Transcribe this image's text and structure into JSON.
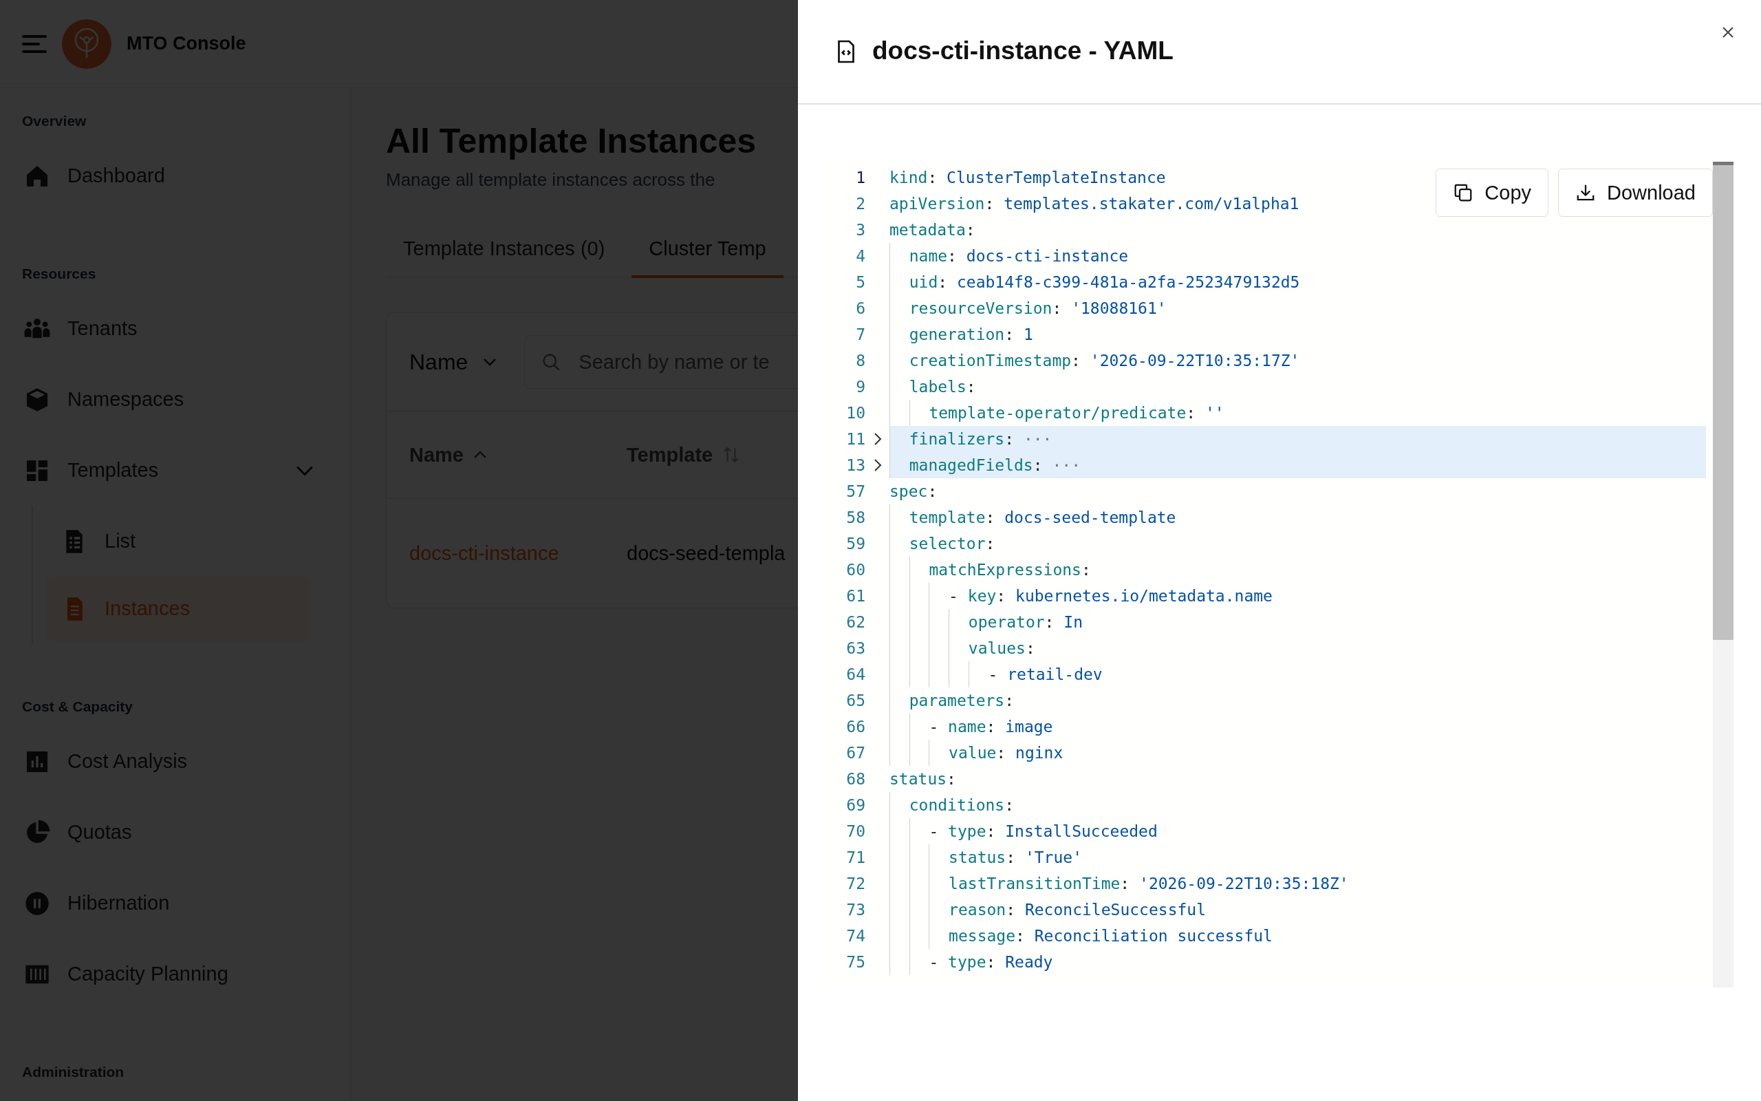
{
  "app": {
    "title": "MTO Console"
  },
  "sidebar": {
    "sections": [
      {
        "label": "Overview",
        "items": [
          {
            "label": "Dashboard",
            "selected": false
          }
        ]
      },
      {
        "label": "Resources",
        "items": [
          {
            "label": "Tenants",
            "selected": false
          },
          {
            "label": "Namespaces",
            "selected": false
          },
          {
            "label": "Templates",
            "selected": false,
            "expanded": true,
            "children": [
              {
                "label": "List",
                "selected": false
              },
              {
                "label": "Instances",
                "selected": true
              }
            ]
          }
        ]
      },
      {
        "label": "Cost & Capacity",
        "items": [
          {
            "label": "Cost Analysis",
            "selected": false
          },
          {
            "label": "Quotas",
            "selected": false
          },
          {
            "label": "Hibernation",
            "selected": false
          },
          {
            "label": "Capacity Planning",
            "selected": false
          }
        ]
      },
      {
        "label": "Administration"
      }
    ]
  },
  "page": {
    "title": "All Template Instances",
    "subtitle": "Manage all template instances across the",
    "tabs": [
      {
        "label": "Template Instances (0)",
        "selected": false
      },
      {
        "label": "Cluster Temp",
        "selected": true
      }
    ],
    "filter": {
      "field": "Name",
      "search_placeholder": "Search by name or te"
    },
    "table": {
      "columns": [
        {
          "label": "Name",
          "sorted": true
        },
        {
          "label": "Template",
          "sorted": false
        }
      ],
      "rows": [
        {
          "cells": [
            "docs-cti-instance",
            "docs-seed-templa"
          ]
        }
      ]
    }
  },
  "drawer": {
    "title": "docs-cti-instance - YAML",
    "buttons": [
      {
        "label": "Copy",
        "kind": "copy"
      },
      {
        "label": "Download",
        "kind": "download"
      }
    ],
    "lines": [
      {
        "number": "1",
        "key": "kind:",
        "value": "ClusterTemplateInstance",
        "current": true,
        "folded": false
      },
      {
        "number": "2",
        "key": "apiVersion:",
        "value": "templates.stakater.com/v1alpha1",
        "current": false,
        "folded": false
      },
      {
        "number": "3",
        "key": "metadata:",
        "current": false,
        "folded": false
      },
      {
        "number": "4",
        "key": "  name:",
        "value": "docs-cti-instance",
        "current": false,
        "folded": false
      },
      {
        "number": "5",
        "key": "  uid:",
        "value": "ceab14f8-c399-481a-a2fa-2523479132d5",
        "current": false,
        "folded": false
      },
      {
        "number": "6",
        "key": "  resourceVersion:",
        "value": "'18088161'",
        "current": false,
        "folded": false
      },
      {
        "number": "7",
        "key": "  generation:",
        "value": "1",
        "current": false,
        "folded": false
      },
      {
        "number": "8",
        "key": "  creationTimestamp:",
        "value": "'2026-09-22T10:35:17Z'",
        "current": false,
        "folded": false
      },
      {
        "number": "9",
        "key": "  labels:",
        "current": false,
        "folded": false
      },
      {
        "number": "10",
        "key": "    template-operator/predicate:",
        "value": "''",
        "current": false,
        "folded": false
      },
      {
        "number": "11",
        "key": "  finalizers:",
        "value": "···",
        "current": false,
        "folded": true
      },
      {
        "number": "13",
        "key": "  managedFields:",
        "value": "···",
        "current": false,
        "folded": true
      },
      {
        "number": "57",
        "key": "spec:",
        "current": false,
        "folded": false
      },
      {
        "number": "58",
        "key": "  template:",
        "value": "docs-seed-template",
        "current": false,
        "folded": false
      },
      {
        "number": "59",
        "key": "  selector:",
        "current": false,
        "folded": false
      },
      {
        "number": "60",
        "key": "    matchExpressions:",
        "current": false,
        "folded": false
      },
      {
        "number": "61",
        "key": "      - key:",
        "value": "kubernetes.io/metadata.name",
        "current": false,
        "folded": false
      },
      {
        "number": "62",
        "key": "        operator:",
        "value": "In",
        "current": false,
        "folded": false
      },
      {
        "number": "63",
        "key": "        values:",
        "current": false,
        "folded": false
      },
      {
        "number": "64",
        "key": "          -",
        "value": "retail-dev",
        "current": false,
        "folded": false
      },
      {
        "number": "65",
        "key": "  parameters:",
        "current": false,
        "folded": false
      },
      {
        "number": "66",
        "key": "    - name:",
        "value": "image",
        "current": false,
        "folded": false
      },
      {
        "number": "67",
        "key": "      value:",
        "value": "nginx",
        "current": false,
        "folded": false
      },
      {
        "number": "68",
        "key": "status:",
        "current": false,
        "folded": false
      },
      {
        "number": "69",
        "key": "  conditions:",
        "current": false,
        "folded": false
      },
      {
        "number": "70",
        "key": "    - type:",
        "value": "InstallSucceeded",
        "current": false,
        "folded": false
      },
      {
        "number": "71",
        "key": "      status:",
        "value": "'True'",
        "current": false,
        "folded": false
      },
      {
        "number": "72",
        "key": "      lastTransitionTime:",
        "value": "'2026-09-22T10:35:18Z'",
        "current": false,
        "folded": false
      },
      {
        "number": "73",
        "key": "      reason:",
        "value": "ReconcileSuccessful",
        "current": false,
        "folded": false
      },
      {
        "number": "74",
        "key": "      message:",
        "value": "Reconciliation successful",
        "current": false,
        "folded": false
      },
      {
        "number": "75",
        "key": "    - type:",
        "value": "Ready",
        "current": false,
        "folded": false
      }
    ]
  }
}
